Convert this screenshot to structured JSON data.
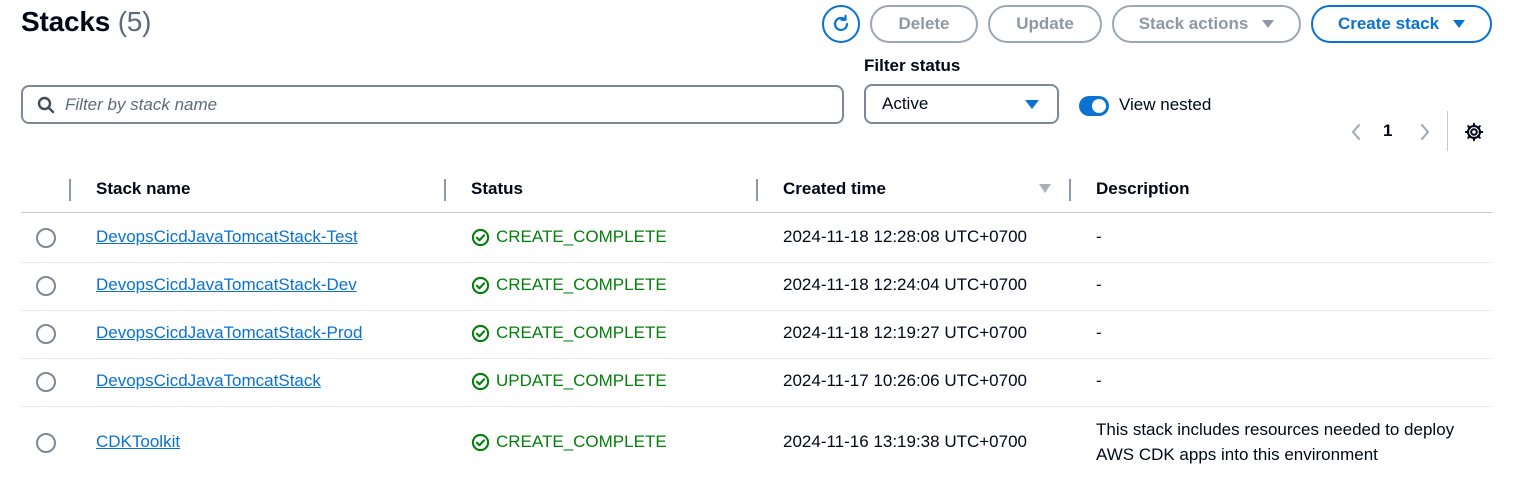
{
  "header": {
    "title": "Stacks",
    "count": "(5)"
  },
  "actions": {
    "delete_label": "Delete",
    "update_label": "Update",
    "stack_actions_label": "Stack actions",
    "create_stack_label": "Create stack"
  },
  "filter": {
    "search_placeholder": "Filter by stack name",
    "search_value": "",
    "status_label": "Filter status",
    "status_value": "Active",
    "view_nested_label": "View nested",
    "view_nested_on": true
  },
  "pagination": {
    "current_page": "1"
  },
  "table": {
    "columns": [
      "Stack name",
      "Status",
      "Created time",
      "Description"
    ],
    "sorted_column": "Created time",
    "rows": [
      {
        "name": "DevopsCicdJavaTomcatStack-Test",
        "status": "CREATE_COMPLETE",
        "created": "2024-11-18 12:28:08 UTC+0700",
        "description": "-"
      },
      {
        "name": "DevopsCicdJavaTomcatStack-Dev",
        "status": "CREATE_COMPLETE",
        "created": "2024-11-18 12:24:04 UTC+0700",
        "description": "-"
      },
      {
        "name": "DevopsCicdJavaTomcatStack-Prod",
        "status": "CREATE_COMPLETE",
        "created": "2024-11-18 12:19:27 UTC+0700",
        "description": "-"
      },
      {
        "name": "DevopsCicdJavaTomcatStack",
        "status": "UPDATE_COMPLETE",
        "created": "2024-11-17 10:26:06 UTC+0700",
        "description": "-"
      },
      {
        "name": "CDKToolkit",
        "status": "CREATE_COMPLETE",
        "created": "2024-11-16 13:19:38 UTC+0700",
        "description": "This stack includes resources needed to deploy AWS CDK apps into this environment"
      }
    ]
  },
  "colors": {
    "accent": "#0972d3",
    "success": "#037f0c",
    "disabled": "#8d99a8"
  },
  "icons": {
    "refresh": "refresh-icon",
    "search": "search-icon",
    "status_ok": "check-circle-icon",
    "settings": "gear-icon"
  }
}
